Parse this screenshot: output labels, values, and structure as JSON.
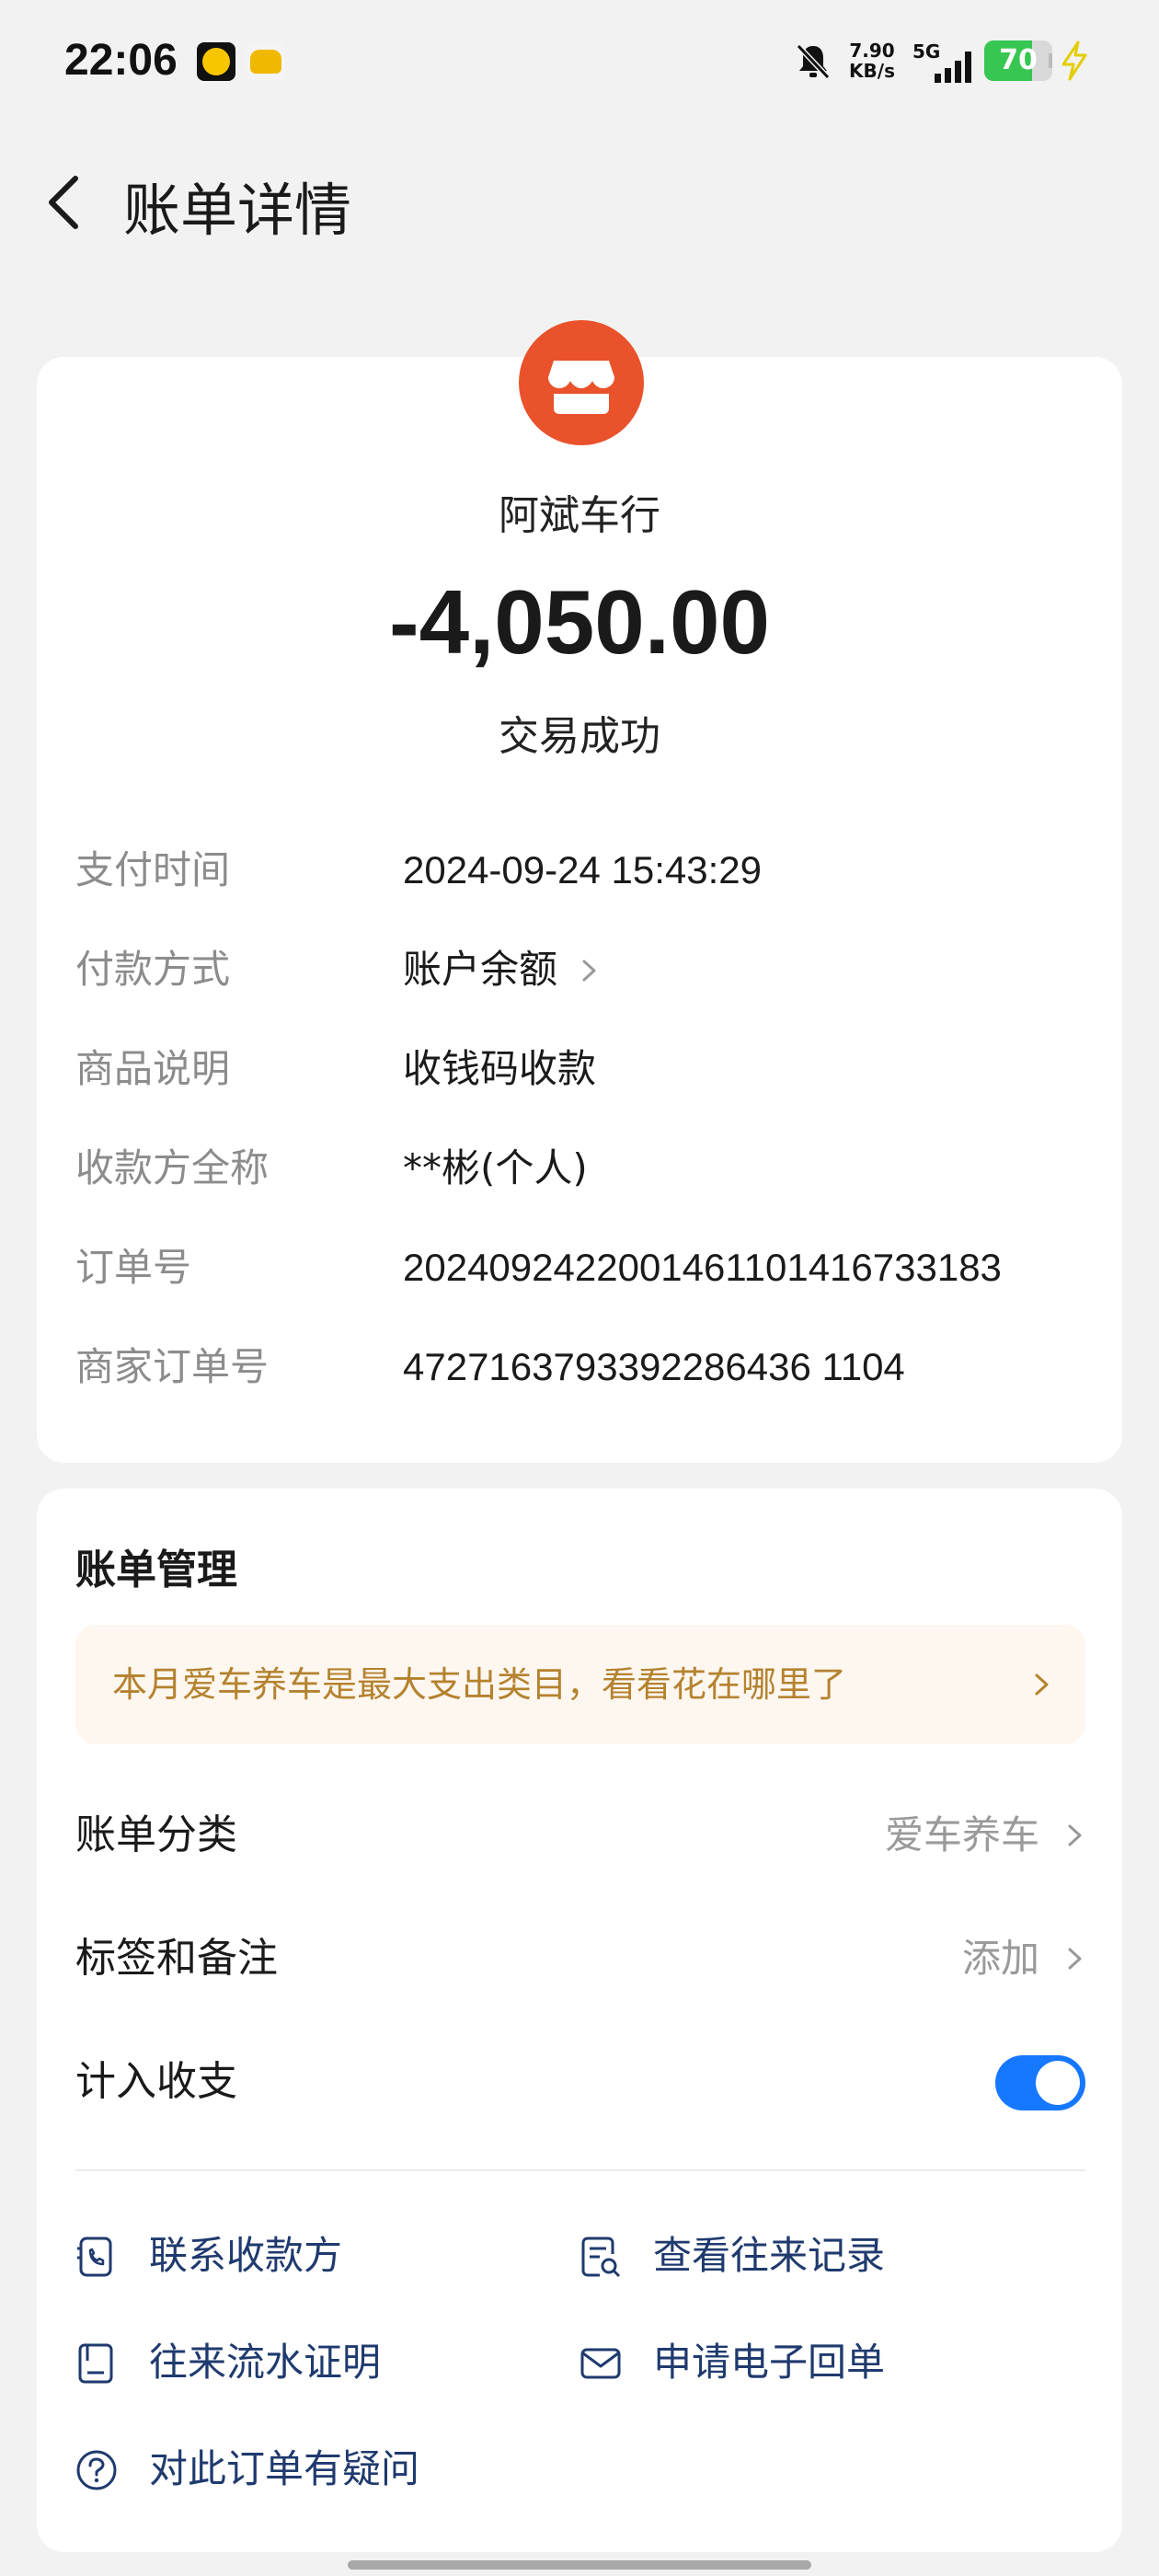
{
  "status_bar": {
    "time": "22:06",
    "net_speed_value": "7.90",
    "net_speed_unit": "KB/s",
    "network": "5G",
    "battery": "70",
    "battery_level": 0.7
  },
  "header": {
    "title": "账单详情"
  },
  "summary": {
    "merchant_name": "阿斌车行",
    "amount": "-4,050.00",
    "status": "交易成功",
    "merchant_icon_color": "#e9522a"
  },
  "details": [
    {
      "label": "支付时间",
      "value": "2024-09-24 15:43:29"
    },
    {
      "label": "付款方式",
      "value": "账户余额"
    },
    {
      "label": "商品说明",
      "value": "收钱码收款"
    },
    {
      "label": "收款方全称",
      "value": "**彬(个人)"
    },
    {
      "label": "订单号",
      "value": "2024092422001461101416733183"
    },
    {
      "label": "商家订单号",
      "value": "4727163793392286436 1104"
    }
  ],
  "management": {
    "title": "账单管理",
    "banner": "本月爱车养车是最大支出类目，看看花在哪里了",
    "category_label": "账单分类",
    "category_value": "爱车养车",
    "tags_label": "标签和备注",
    "tags_value": "添加",
    "include_label": "计入收支",
    "include_enabled": true
  },
  "actions": {
    "contact": "联系收款方",
    "records": "查看往来记录",
    "statement": "往来流水证明",
    "receipt": "申请电子回单",
    "question": "对此订单有疑问"
  },
  "colors": {
    "accent": "#1677ff",
    "banner_text": "#b5822f",
    "action_text": "#1f3a6e"
  }
}
